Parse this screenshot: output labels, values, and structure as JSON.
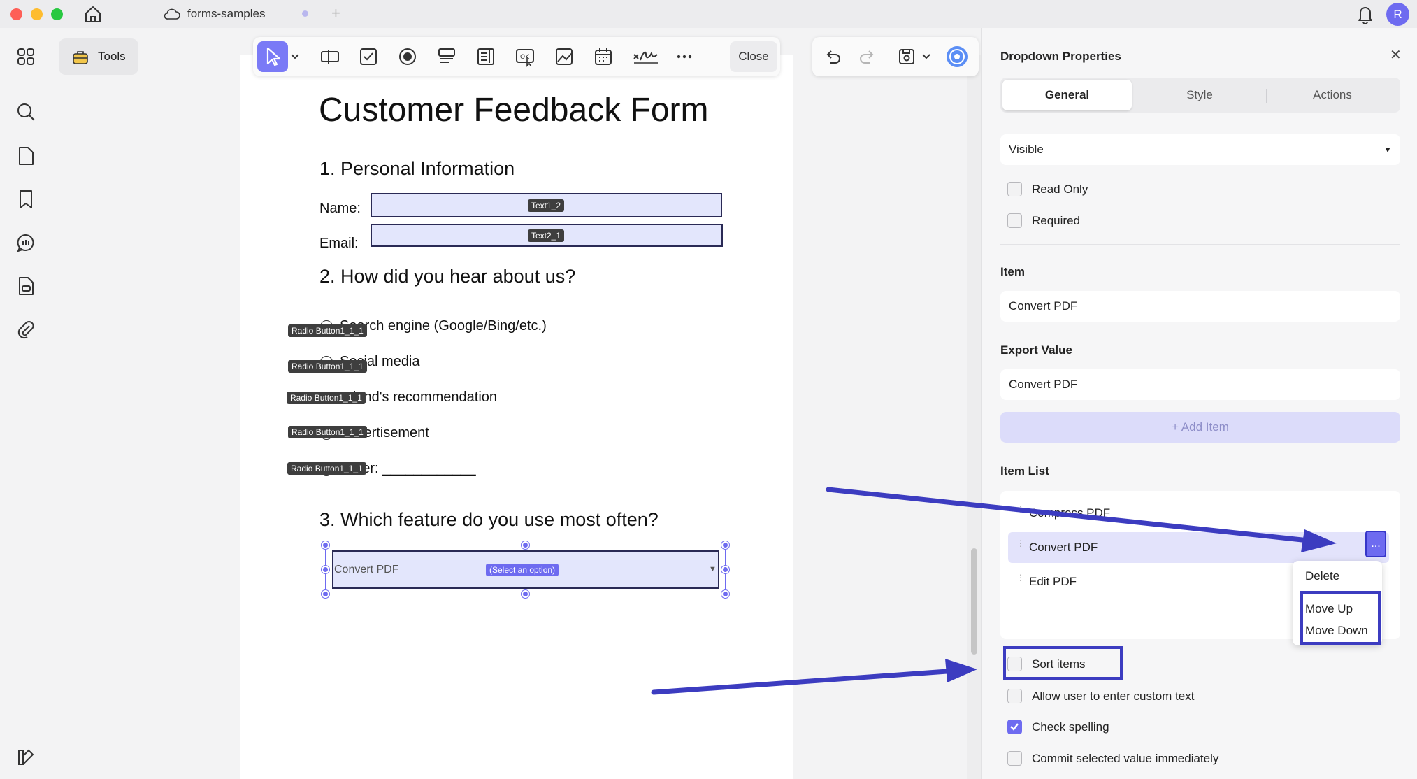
{
  "titlebar": {
    "tab_title": "forms-samples",
    "avatar_initial": "R"
  },
  "sidebar": {
    "tools_label": "Tools"
  },
  "toolbar": {
    "close_label": "Close"
  },
  "document": {
    "title": "Customer Feedback Form",
    "section1": "1. Personal Information",
    "name_label": "Name:",
    "email_label": "Email:",
    "name_field_tag": "Text1_2",
    "email_field_tag": "Text2_1",
    "section2": "2. How did you hear about us?",
    "radio_tag": "Radio Button1_1_1",
    "options": [
      "Search engine (Google/Bing/etc.)",
      "Social media",
      "Friend's recommendation",
      "Advertisement",
      "Other: ____________"
    ],
    "section3": "3. Which feature do you use most often?",
    "dropdown_value": "Convert PDF",
    "dropdown_tag": "(Select an option)"
  },
  "panel": {
    "title": "Dropdown Properties",
    "tabs": [
      "General",
      "Style",
      "Actions"
    ],
    "visibility_value": "Visible",
    "read_only_label": "Read Only",
    "required_label": "Required",
    "item_label": "Item",
    "item_value": "Convert PDF",
    "export_label": "Export Value",
    "export_value": "Convert PDF",
    "add_item_label": "+ Add Item",
    "item_list_label": "Item List",
    "items": [
      "Compress PDF",
      "Convert PDF",
      "Edit PDF"
    ],
    "more_glyph": "...",
    "context_menu": [
      "Delete",
      "Move Up",
      "Move Down"
    ],
    "options": [
      {
        "label": "Sort items",
        "checked": false
      },
      {
        "label": "Allow user to enter custom text",
        "checked": false
      },
      {
        "label": "Check spelling",
        "checked": true
      },
      {
        "label": "Commit selected value immediately",
        "checked": false
      }
    ]
  },
  "colors": {
    "accent": "#6e6bf0",
    "highlight_box": "#3c3cc0",
    "field_fill": "#e3e6fc"
  }
}
